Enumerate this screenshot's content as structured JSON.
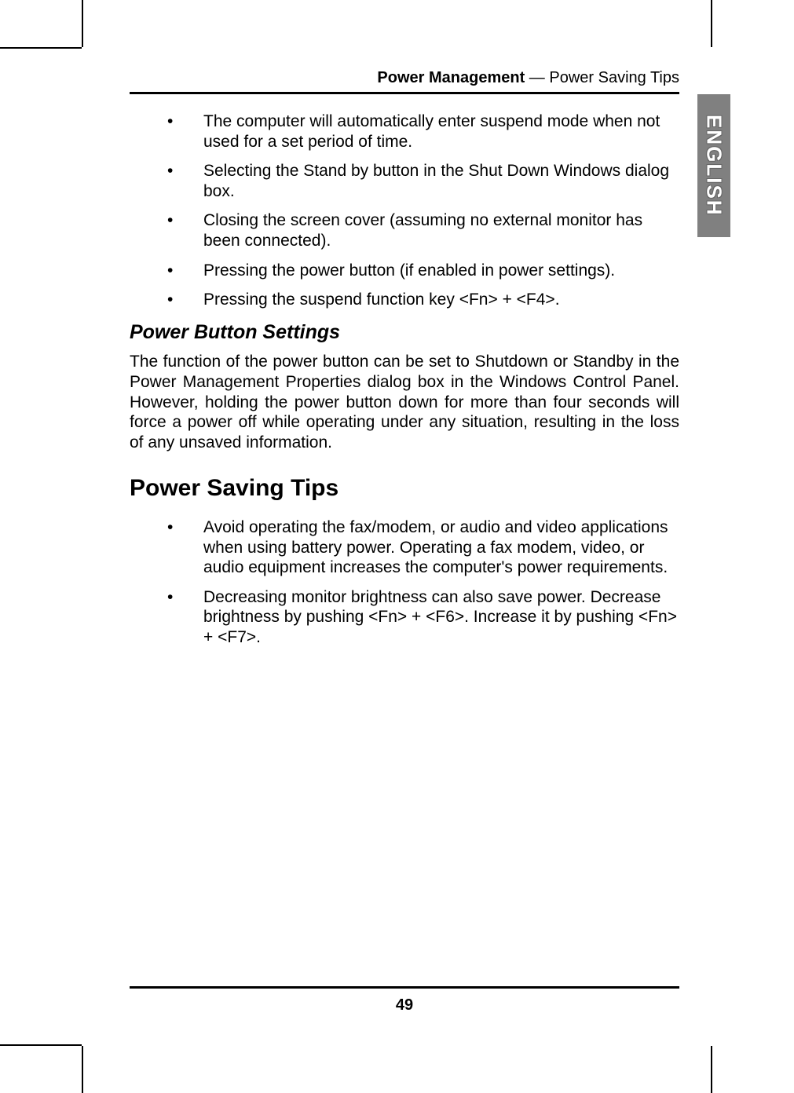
{
  "header": {
    "section": "Power Management",
    "separator": " — ",
    "topic": "Power Saving Tips"
  },
  "sideTab": "ENGLISH",
  "suspendBullets": [
    "The computer will automatically enter suspend mode when not used for a set period of time.",
    "Selecting the Stand by button in the Shut Down Windows dialog box.",
    "Closing the screen cover (assuming no external monitor has been connected).",
    "Pressing the power button (if enabled in power settings).",
    "Pressing the suspend function key <Fn> + <F4>."
  ],
  "powerButton": {
    "heading": "Power Button Settings",
    "body": "The function of the power button can be set to Shutdown or Standby in the Power Management Properties dialog box in the Windows Control Panel. However, holding the power button down for more than four seconds will force a power off while operating under any situation, resulting in the loss of any unsaved information."
  },
  "tips": {
    "heading": "Power Saving Tips",
    "items": [
      "Avoid operating the fax/modem, or audio and video applications when using battery power. Operating a fax modem, video, or audio equipment increases the computer's power requirements.",
      "Decreasing monitor brightness can also save power. Decrease brightness by pushing <Fn> + <F6>. Increase it by pushing <Fn> + <F7>."
    ]
  },
  "pageNumber": "49"
}
